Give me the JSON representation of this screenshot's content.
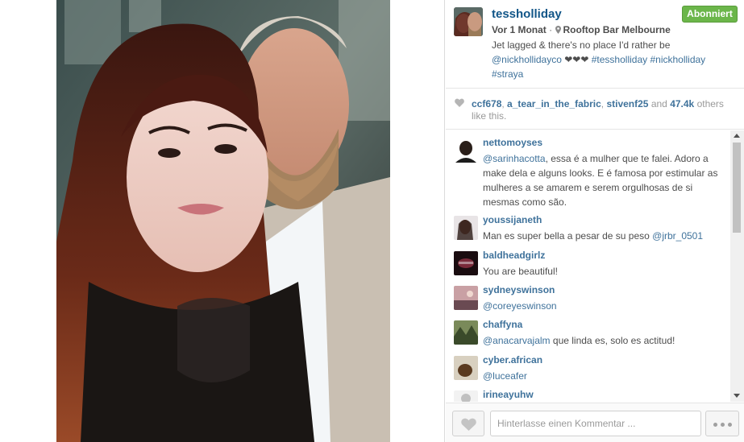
{
  "post": {
    "username": "tessholliday",
    "follow_label": "Abonniert",
    "time": "Vor 1 Monat",
    "separator": " · ",
    "location": "Rooftop Bar Melbourne",
    "caption": {
      "text": "Jet lagged & there's no place I'd rather be",
      "mention": "@nickhollidayco",
      "emoji": "❤❤❤",
      "tag1": "#tessholliday",
      "tag2": "#nickholliday",
      "tag3": "#straya"
    }
  },
  "likes": {
    "user1": "ccf678",
    "user2": "a_tear_in_the_fabric",
    "user3": "stivenf25",
    "and": "and",
    "count": "47.4k",
    "suffix": "others like this."
  },
  "comments": [
    {
      "user": "nettomoyses",
      "mention": "@sarinhacotta",
      "text": ", essa é a mulher que te falei. Adoro a make dela e alguns looks. E é famosa por estimular as mulheres a se amarem e serem orgulhosas de si mesmas como são."
    },
    {
      "user": "youssijaneth",
      "mention": "",
      "text": "Man es super bella a pesar de su peso ",
      "mention_after": "@jrbr_0501"
    },
    {
      "user": "baldheadgirlz",
      "mention": "",
      "text": "You are beautiful!"
    },
    {
      "user": "sydneyswinson",
      "mention": "@coreyeswinson",
      "text": ""
    },
    {
      "user": "chaffyna",
      "mention": "@anacarvajalm",
      "text": " que linda es, solo es actitud!"
    },
    {
      "user": "cyber.african",
      "mention": "@luceafer",
      "text": ""
    },
    {
      "user": "irineayuhw",
      "mention": "",
      "text": ""
    }
  ],
  "footer": {
    "comment_placeholder": "Hinterlasse einen Kommentar ..."
  },
  "colors": {
    "link": "#3f729b",
    "username": "#125688",
    "follow_green": "#6bb64a"
  },
  "icons": [
    "pin-icon",
    "heart-icon",
    "more-icon"
  ]
}
